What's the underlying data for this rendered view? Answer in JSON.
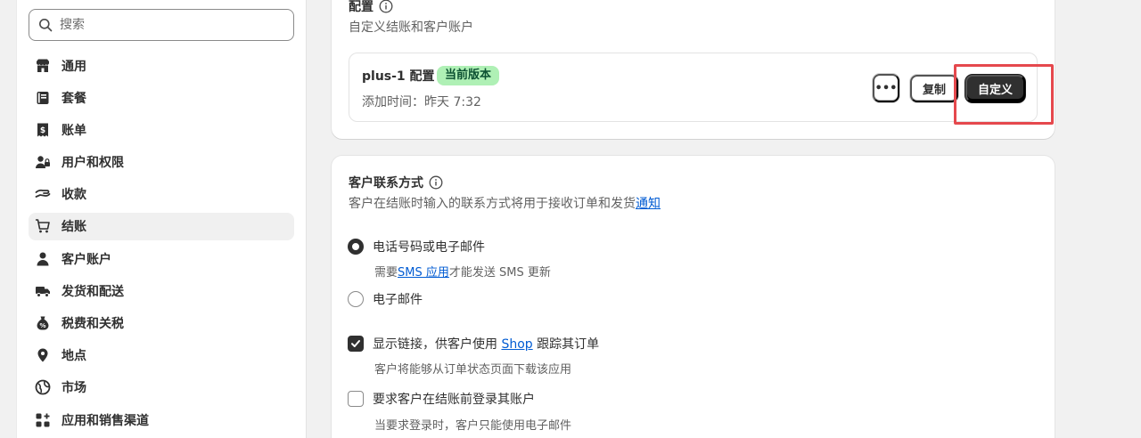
{
  "search": {
    "placeholder": "搜索"
  },
  "sidebar": {
    "items": [
      {
        "label": "通用",
        "icon": "store-icon"
      },
      {
        "label": "套餐",
        "icon": "plan-icon"
      },
      {
        "label": "账单",
        "icon": "billing-icon"
      },
      {
        "label": "用户和权限",
        "icon": "users-icon"
      },
      {
        "label": "收款",
        "icon": "payments-icon"
      },
      {
        "label": "结账",
        "icon": "cart-icon",
        "active": true
      },
      {
        "label": "客户账户",
        "icon": "person-icon"
      },
      {
        "label": "发货和配送",
        "icon": "truck-icon"
      },
      {
        "label": "税费和关税",
        "icon": "tax-icon"
      },
      {
        "label": "地点",
        "icon": "location-icon"
      },
      {
        "label": "市场",
        "icon": "globe-icon"
      },
      {
        "label": "应用和销售渠道",
        "icon": "apps-icon"
      }
    ]
  },
  "config": {
    "title": "配置",
    "subtitle": "自定义结账和客户账户",
    "name": "plus-1 配置",
    "badge": "当前版本",
    "added": "添加时间：昨天 7:32",
    "more_label": "•••",
    "copy_label": "复制",
    "customize_label": "自定义"
  },
  "contact": {
    "title": "客户联系方式",
    "subtitle_prefix": "客户在结账时输入的联系方式将用于接收订单和发货",
    "subtitle_link": "通知",
    "option1": "电话号码或电子邮件",
    "option1_help_prefix": "需要",
    "option1_help_link": "SMS 应用",
    "option1_help_suffix": "才能发送 SMS 更新",
    "option2": "电子邮件",
    "check1_prefix": "显示链接，供客户使用 ",
    "check1_link": "Shop",
    "check1_suffix": " 跟踪其订单",
    "check1_help": "客户将能够从订单状态页面下载该应用",
    "check2": "要求客户在结账前登录其账户",
    "check2_help": "当要求登录时，客户只能使用电子邮件"
  },
  "colors": {
    "accent": "#303030",
    "badge_bg": "#aff0b5",
    "link": "#005bd3",
    "highlight": "#e5484d"
  }
}
